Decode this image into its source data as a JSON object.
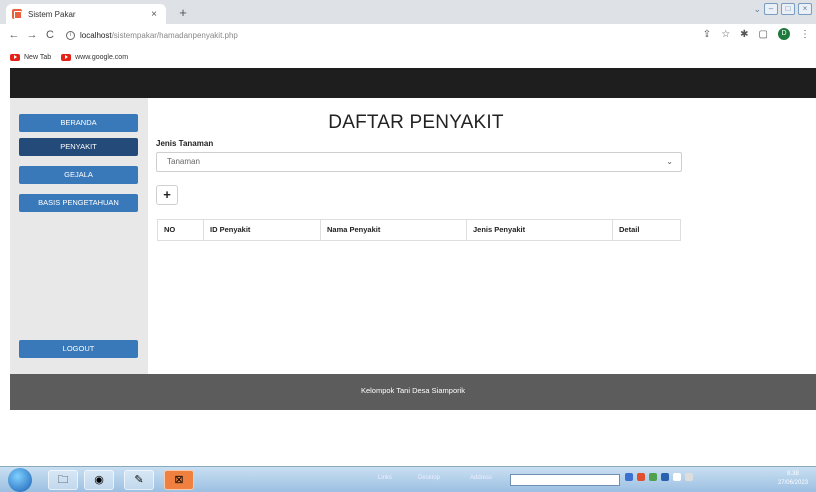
{
  "browser": {
    "tab_title": "Sistem Pakar",
    "tab_close": "×",
    "new_tab": "+",
    "url_host": "localhost",
    "url_path": "/sistempakar/hamadanpenyakit.php",
    "profile_initial": "D",
    "bookmarks": [
      "New Tab",
      "www.google.com"
    ]
  },
  "sidebar": {
    "items": [
      {
        "label": "BERANDA",
        "active": false
      },
      {
        "label": "PENYAKIT",
        "active": true
      },
      {
        "label": "GEJALA",
        "active": false
      },
      {
        "label": "BASIS PENGETAHUAN",
        "active": false
      }
    ],
    "logout_label": "LOGOUT"
  },
  "main": {
    "title": "DAFTAR PENYAKIT",
    "jenis_label": "Jenis Tanaman",
    "select_value": "Tanaman",
    "add_label": "+",
    "table_headers": [
      "NO",
      "ID Penyakit",
      "Nama Penyakit",
      "Jenis Penyakit",
      "Detail"
    ]
  },
  "footer": {
    "text": "Kelompok Tani Desa Siamporik"
  },
  "taskbar": {
    "links_label": "Links",
    "desktop_label": "Desktop",
    "address_label": "Address",
    "time": "8.38",
    "date": "27/06/2023"
  },
  "colors": {
    "sidebar_button": "#3a79b9",
    "sidebar_button_active": "#234a79",
    "header": "#1e1e1e",
    "footer": "#5c5c5c"
  }
}
